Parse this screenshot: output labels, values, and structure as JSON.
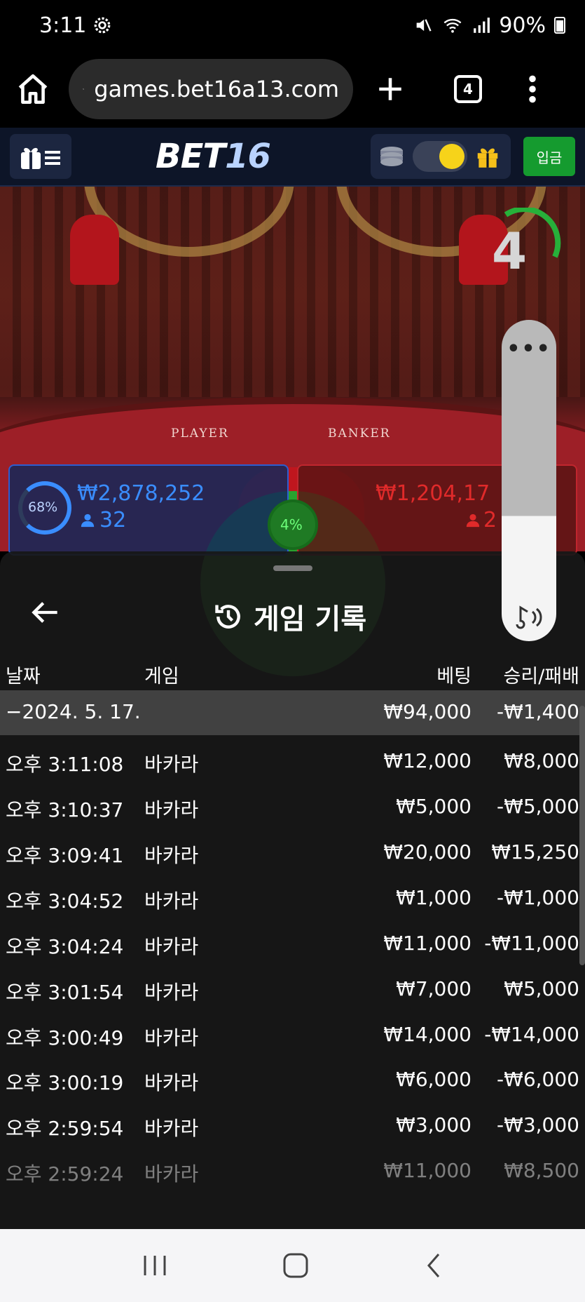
{
  "status_bar": {
    "time": "3:11",
    "battery": "90%",
    "icons": [
      "settings-icon",
      "mute-icon",
      "wifi-icon",
      "signal-icon",
      "battery-icon"
    ]
  },
  "browser": {
    "url": "games.bet16a13.com",
    "tab_count": "4",
    "icons": [
      "home-icon",
      "site-settings-icon",
      "new-tab-icon",
      "tabs-icon",
      "more-vert-icon"
    ]
  },
  "site_header": {
    "logo_bet": "BET",
    "logo_num": "16",
    "deposit_label": "입금",
    "icons": [
      "gift-menu-icon",
      "coins-icon",
      "gift-icon"
    ]
  },
  "game": {
    "table_left": "PLAYER",
    "table_right": "BANKER",
    "countdown": "4",
    "player": {
      "pct": "68%",
      "amount": "₩2,878,252",
      "users": "32"
    },
    "banker": {
      "amount": "₩1,204,17",
      "users": "2"
    },
    "tie": {
      "pct": "4%"
    }
  },
  "history": {
    "title": "게임 기록",
    "columns": {
      "date": "날짜",
      "game": "게임",
      "bet": "베팅",
      "winloss": "승리/패배"
    },
    "summary": {
      "date": "−2024. 5. 17.",
      "bet": "₩94,000",
      "winloss": "-₩1,400"
    },
    "rows": [
      {
        "time": "오후 3:11:08",
        "game": "바카라",
        "bet": "₩12,000",
        "winloss": "₩8,000"
      },
      {
        "time": "오후 3:10:37",
        "game": "바카라",
        "bet": "₩5,000",
        "winloss": "-₩5,000"
      },
      {
        "time": "오후 3:09:41",
        "game": "바카라",
        "bet": "₩20,000",
        "winloss": "₩15,250"
      },
      {
        "time": "오후 3:04:52",
        "game": "바카라",
        "bet": "₩1,000",
        "winloss": "-₩1,000"
      },
      {
        "time": "오후 3:04:24",
        "game": "바카라",
        "bet": "₩11,000",
        "winloss": "-₩11,000"
      },
      {
        "time": "오후 3:01:54",
        "game": "바카라",
        "bet": "₩7,000",
        "winloss": "₩5,000"
      },
      {
        "time": "오후 3:00:49",
        "game": "바카라",
        "bet": "₩14,000",
        "winloss": "-₩14,000"
      },
      {
        "time": "오후 3:00:19",
        "game": "바카라",
        "bet": "₩6,000",
        "winloss": "-₩6,000"
      },
      {
        "time": "오후 2:59:54",
        "game": "바카라",
        "bet": "₩3,000",
        "winloss": "-₩3,000"
      },
      {
        "time": "오후 2:59:24",
        "game": "바카라",
        "bet": "₩11,000",
        "winloss": "₩8,500"
      }
    ]
  },
  "volume": {
    "level": 0.39,
    "dots": "•••"
  },
  "colors": {
    "player_blue": "#3a8dff",
    "banker_red": "#e02a2a",
    "tie_green": "#2aa22f",
    "deposit_green": "#159b2f",
    "toggle_yellow": "#f6d31a"
  }
}
